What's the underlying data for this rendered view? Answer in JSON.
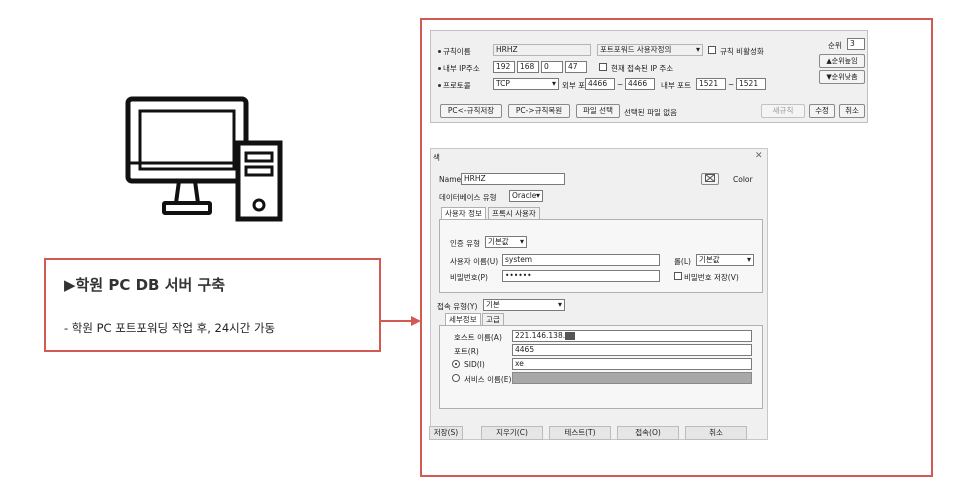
{
  "left": {
    "title": "▶학원 PC DB 서버 구축",
    "description": "-  학원 PC 포트포워딩 작업 후, 24시간 가동"
  },
  "port_forwarding": {
    "rule_name_label": "규칙이름",
    "rule_name_value": "HRHZ",
    "port_forward_select": "포트포워드 사용자정의",
    "disable_rule_label": "규칙 비활성화",
    "internal_ip_label": "내부 IP주소",
    "ip": [
      "192",
      "168",
      "0",
      "47"
    ],
    "current_ip_label": "현재 접속된 IP 주소",
    "protocol_label": "프로토콜",
    "protocol_value": "TCP",
    "external_port_label": "외부 포트",
    "external_port_from": "4466",
    "external_port_to": "4466",
    "internal_port_label": "내부 포트",
    "internal_port_from": "1521",
    "internal_port_to": "1521",
    "tilde": "~",
    "order_label": "순위",
    "order_value": "3",
    "order_up": "▲순위높임",
    "order_down": "▼순위낮춤",
    "btn_save_rules": "PC<-규칙저장",
    "btn_restore_rules": "PC->규칙복원",
    "btn_file_select": "파일 선택",
    "file_status": "선택된 파일 없음",
    "btn_new_rule": "새규칙",
    "btn_edit": "수정",
    "btn_cancel": "취소"
  },
  "db_dialog": {
    "title_fragment": "색",
    "close": "✕",
    "name_label": "Name",
    "name_value": "HRHZ",
    "color_label": "Color",
    "db_type_label": "데이터베이스 유형",
    "db_type_value": "Oracle",
    "tab_user_info": "사용자 정보",
    "tab_proxy_user": "프록시 사용자",
    "auth_type_label": "인증 유형",
    "auth_type_value": "기본값",
    "username_label": "사용자 이름(U)",
    "username_value": "system",
    "role_label": "롤(L)",
    "role_value": "기본값",
    "password_label": "비밀번호(P)",
    "password_value": "••••••",
    "save_password_label": "비밀번호 저장(V)",
    "conn_type_label": "접속 유형(Y)",
    "conn_type_value": "기본",
    "tab_details": "세부정보",
    "tab_advanced": "고급",
    "host_label": "호스트 이름(A)",
    "host_value": "221.146.138.",
    "port_label": "포트(R)",
    "port_value": "4465",
    "sid_label": "SID(I)",
    "sid_value": "xe",
    "service_label": "서비스 이름(E)",
    "btn_save": "저장(S)",
    "btn_clear": "지우기(C)",
    "btn_test": "테스트(T)",
    "btn_connect": "접속(O)",
    "btn_cancel": "취소"
  },
  "colors": {
    "accent_red": "#d35a52",
    "icon_black": "#111111"
  }
}
